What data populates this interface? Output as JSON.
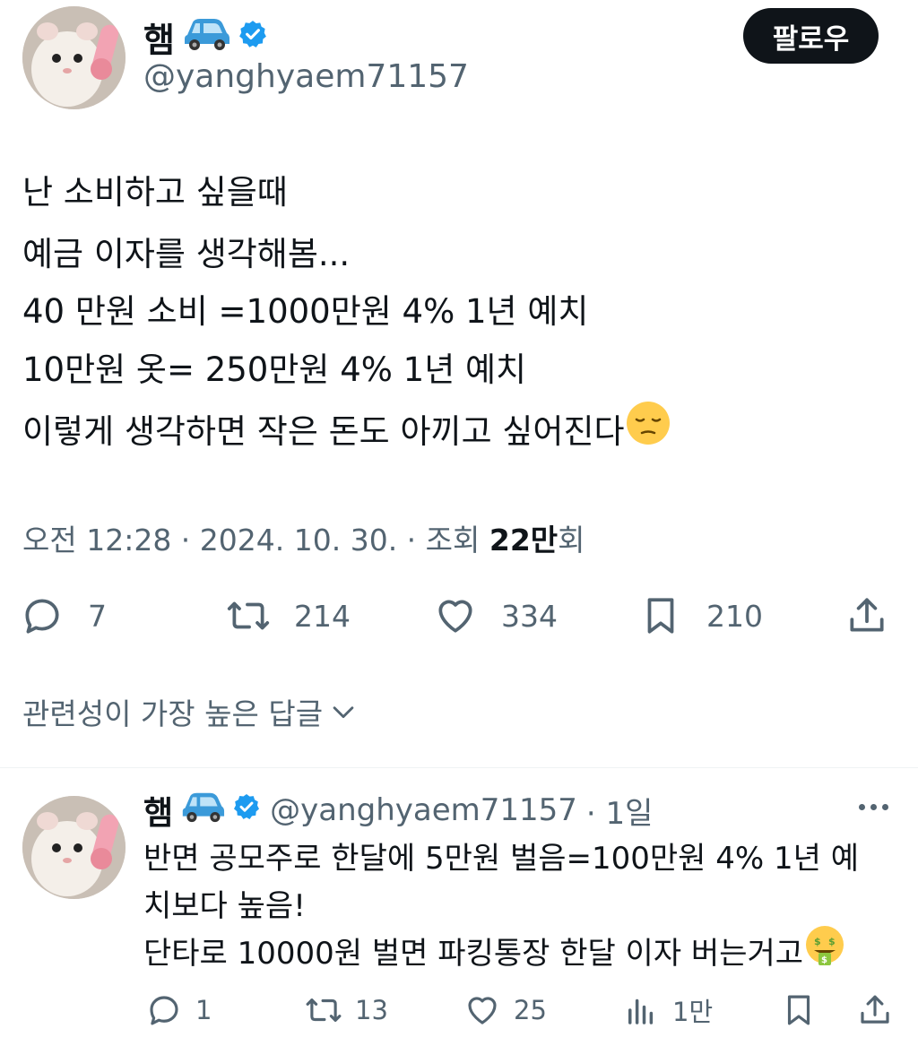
{
  "post": {
    "author_name": "햄",
    "author_handle": "@yanghyaem71157",
    "follow_label": "팔로우",
    "lines": [
      "난 소비하고 싶을때",
      "예금 이자를 생각해봄...",
      "40 만원 소비 =1000만원 4% 1년 예치",
      "10만원 옷= 250만원 4% 1년 예치",
      "이렇게 생각하면 작은 돈도 아끼고 싶어진다"
    ],
    "meta_time": "오전 12:28 · 2024. 10. 30. · 조회 ",
    "meta_views": "22만",
    "meta_views_suffix": "회",
    "stats": {
      "replies": "7",
      "reposts": "214",
      "likes": "334",
      "bookmarks": "210"
    }
  },
  "replies_sort": {
    "label": "관련성이 가장 높은 답글"
  },
  "reply": {
    "author_name": "햄",
    "author_handle": "@yanghyaem71157",
    "time": "· 1일",
    "lines": [
      "반면 공모주로 한달에 5만원 벌음=100만원 4% 1년 예",
      "치보다 높음!",
      "단타로 10000원 벌면 파킹통장 한달 이자 버는거고"
    ],
    "stats": {
      "replies": "1",
      "reposts": "13",
      "likes": "25",
      "views": "1만"
    }
  },
  "colors": {
    "text": "#0f1419",
    "secondary": "#536471",
    "verified": "#1d9bf0",
    "car": "#3b9ad9"
  },
  "icons": [
    "car-emoji-icon",
    "verified-badge-icon",
    "pensive-face-emoji-icon",
    "reply-icon",
    "repost-icon",
    "like-icon",
    "bookmark-icon",
    "share-icon",
    "chevron-down-icon",
    "views-icon",
    "more-icon",
    "money-mouth-face-emoji-icon"
  ]
}
